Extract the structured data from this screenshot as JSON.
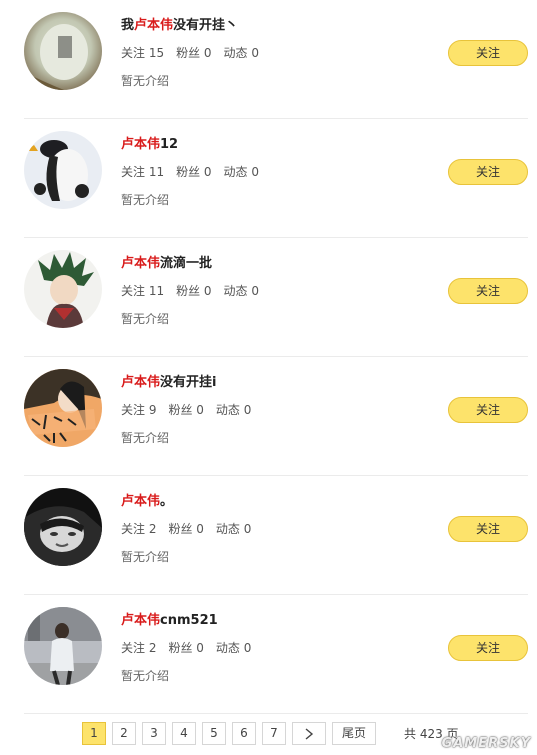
{
  "users": [
    {
      "name_prefix": "我",
      "name_highlight": "卢本伟",
      "name_suffix": "没有开挂丶",
      "following": "关注 15",
      "fans": "粉丝 0",
      "posts": "动态 0",
      "intro": "暂无介绍",
      "follow_label": "关注",
      "avatar": "avatar-blurred-photo"
    },
    {
      "name_prefix": "",
      "name_highlight": "卢本伟",
      "name_suffix": "12",
      "following": "关注 11",
      "fans": "粉丝 0",
      "posts": "动态 0",
      "intro": "暂无介绍",
      "follow_label": "关注",
      "avatar": "avatar-penguin"
    },
    {
      "name_prefix": "",
      "name_highlight": "卢本伟",
      "name_suffix": "流滴一批",
      "following": "关注 11",
      "fans": "粉丝 0",
      "posts": "动态 0",
      "intro": "暂无介绍",
      "follow_label": "关注",
      "avatar": "avatar-anime-character"
    },
    {
      "name_prefix": "",
      "name_highlight": "卢本伟",
      "name_suffix": "没有开挂i",
      "following": "关注 9",
      "fans": "粉丝 0",
      "posts": "动态 0",
      "intro": "暂无介绍",
      "follow_label": "关注",
      "avatar": "avatar-girl-orange"
    },
    {
      "name_prefix": "",
      "name_highlight": "卢本伟",
      "name_suffix": "。",
      "following": "关注 2",
      "fans": "粉丝 0",
      "posts": "动态 0",
      "intro": "暂无介绍",
      "follow_label": "关注",
      "avatar": "avatar-bw-face"
    },
    {
      "name_prefix": "",
      "name_highlight": "卢本伟",
      "name_suffix": "cnm521",
      "following": "关注 2",
      "fans": "粉丝 0",
      "posts": "动态 0",
      "intro": "暂无介绍",
      "follow_label": "关注",
      "avatar": "avatar-person-street"
    }
  ],
  "pagination": {
    "pages": [
      "1",
      "2",
      "3",
      "4",
      "5",
      "6",
      "7"
    ],
    "current": "1",
    "next_icon": "chevron-right-icon",
    "last_label": "尾页",
    "total": "共 423 页"
  },
  "watermark": "GAMERSKY",
  "colors": {
    "accent": "#fde36b",
    "accent_border": "#e8c33a",
    "highlight": "#d91c1c"
  }
}
